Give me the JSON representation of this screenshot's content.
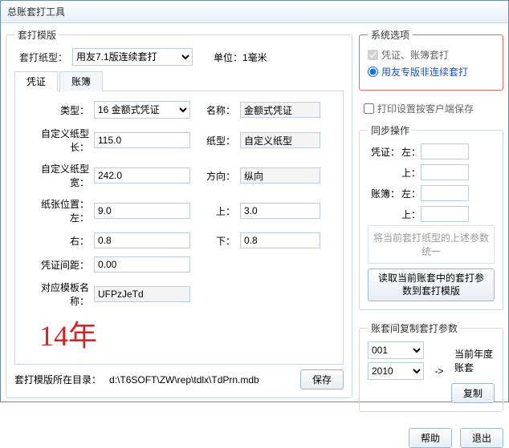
{
  "title": "总账套打工具",
  "template": {
    "legend": "套打模版",
    "paperTypeLabel": "套打纸型：",
    "paperTypeValue": "用友7.1版连续套打",
    "unitLabel": "单位：1毫米",
    "tabs": {
      "voucher": "凭证",
      "ledger": "账簿"
    },
    "form": {
      "typeLabel": "类型：",
      "typeValue": "16 金额式凭证",
      "nameLabel": "名称：",
      "nameValue": "金额式凭证",
      "custLenLabel": "自定义纸型长：",
      "custLen": "115.0",
      "paperLabel": "纸型：",
      "paperValue": "自定义纸型",
      "custWidLabel": "自定义纸型宽：",
      "custWid": "242.0",
      "dirLabel": "方向：",
      "dirValue": "纵向",
      "posLabel": "纸张位置：左：",
      "posLeft": "9.0",
      "posTopLabel": "上：",
      "posTop": "3.0",
      "posRightLabel": "右：",
      "posRight": "0.8",
      "posBottomLabel": "下：",
      "posBottom": "0.8",
      "gapLabel": "凭证间距：",
      "gap": "0.00",
      "tplNameLabel": "对应模板名称：",
      "tplName": "UFPzJeTd"
    },
    "handwrite": "14年",
    "pathLabel": "套打模版所在目录：",
    "path": "d:\\T6SOFT\\ZW\\rep\\tdlx\\TdPrn.mdb",
    "save": "保存"
  },
  "sysopt": {
    "legend": "系统选项",
    "chk1": "凭证、账簿套打",
    "radio1": "用友专版非连续套打",
    "chk2": "打印设置按客户端保存"
  },
  "sync": {
    "legend": "同步操作",
    "voucher": "凭证：",
    "ledger": "账簿：",
    "left": "左：",
    "top": "上：",
    "note": "将当前套打纸型的上述参数统一",
    "btn": "读取当前账套中的套打参数到套打模版"
  },
  "copy": {
    "legend": "账套间复制套打参数",
    "src": "001",
    "dst": "2010",
    "arrow": "->",
    "target": "当前年度账套",
    "btn": "复制"
  },
  "footer": {
    "help": "帮助",
    "exit": "退出"
  }
}
